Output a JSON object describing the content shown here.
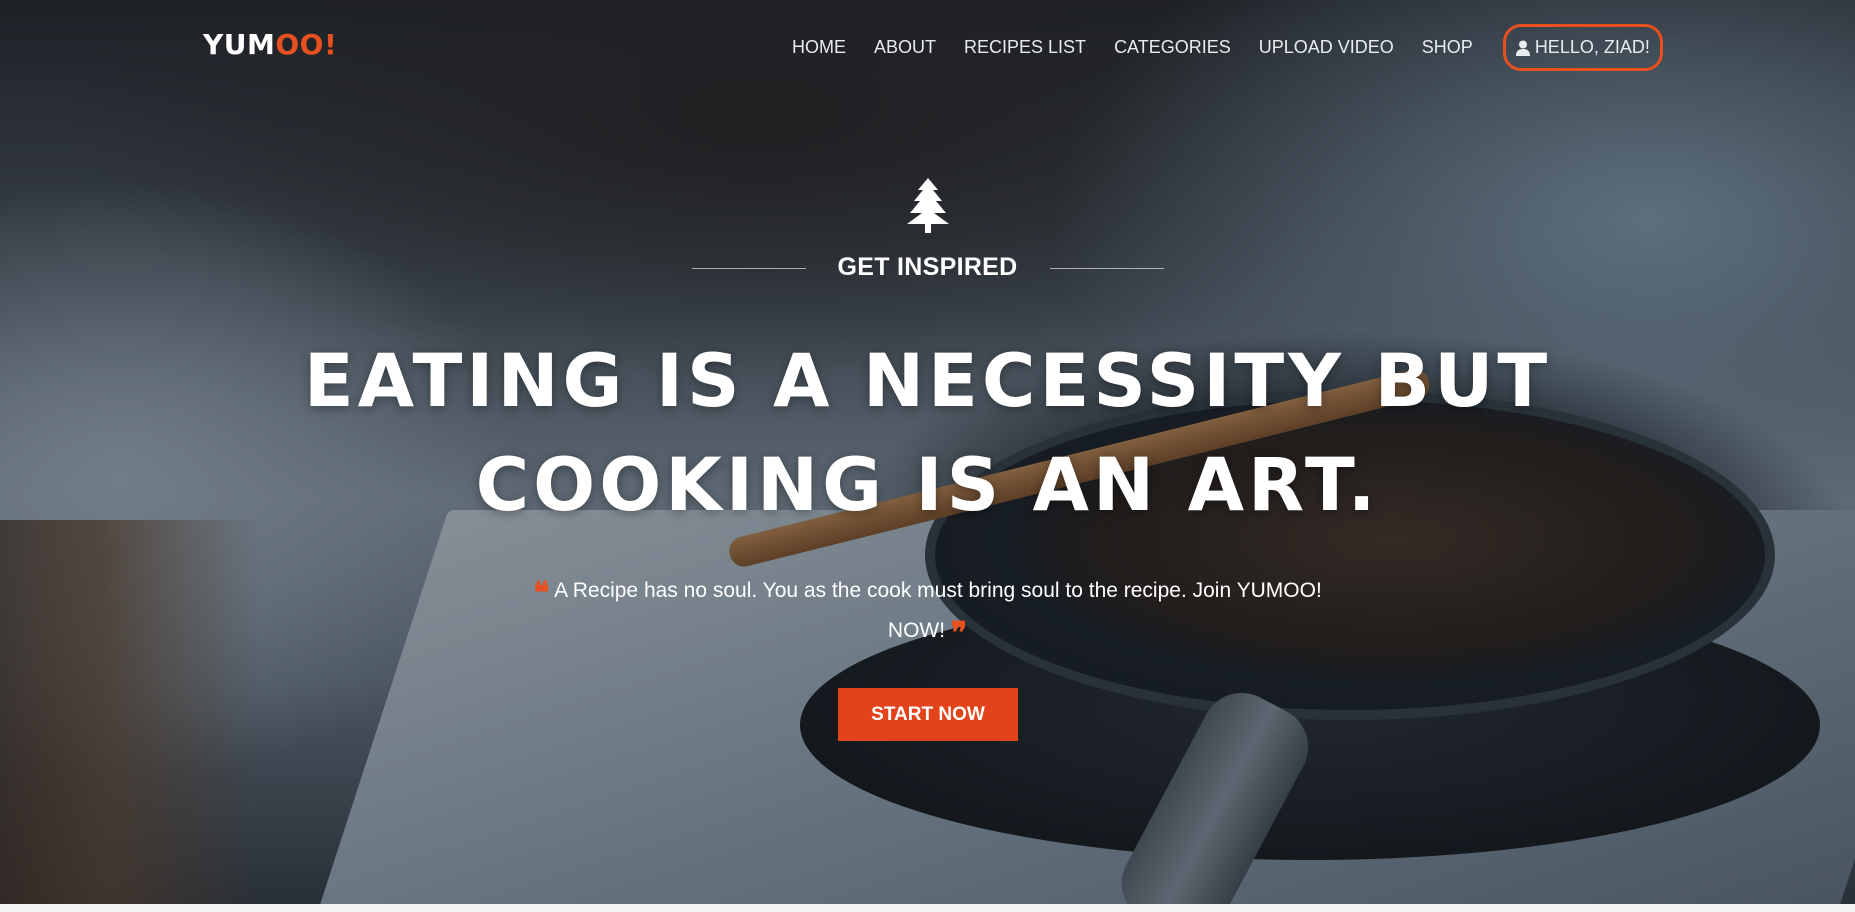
{
  "brand": {
    "logo_main": "YUM",
    "logo_accent": "OO!",
    "accent_color": "#e8501f"
  },
  "nav": {
    "items": [
      {
        "label": "HOME"
      },
      {
        "label": "ABOUT"
      },
      {
        "label": "RECIPES LIST"
      },
      {
        "label": "CATEGORIES"
      },
      {
        "label": "UPLOAD VIDEO"
      },
      {
        "label": "SHOP"
      }
    ],
    "user_label": "HELLO, ZIAD!",
    "user_icon": "user-icon"
  },
  "hero": {
    "icon": "tree-icon",
    "kicker": "GET INSPIRED",
    "headline_line1": "EATING IS A NECESSITY BUT",
    "headline_line2": "COOKING IS AN ART.",
    "quote_open": "❝",
    "quote_text": "A Recipe has no soul. You as the cook must bring soul to the recipe. Join YUMOO! NOW!",
    "quote_close": "❞",
    "cta_label": "START NOW",
    "cta_color": "#e2431a"
  }
}
